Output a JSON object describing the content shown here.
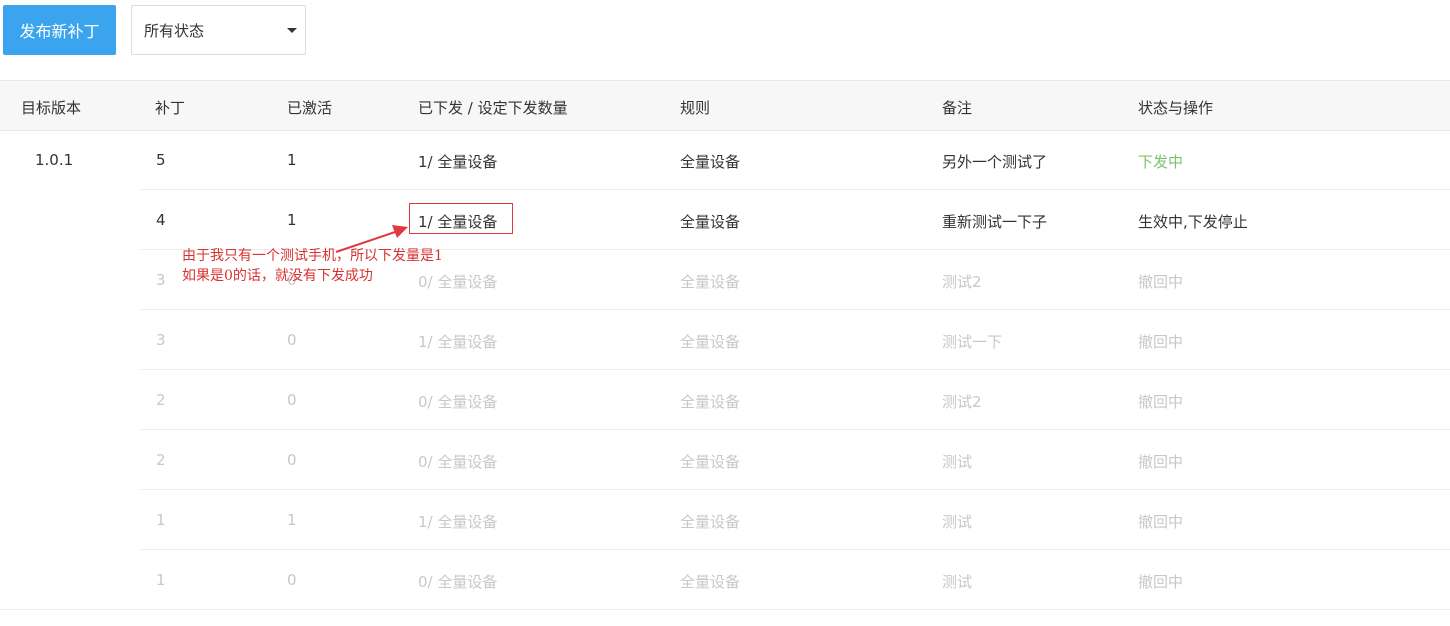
{
  "toolbar": {
    "publish_label": "发布新补丁",
    "status_select": "所有状态"
  },
  "table": {
    "headers": [
      "目标版本",
      "补丁",
      "已激活",
      "已下发 / 设定下发数量",
      "规则",
      "备注",
      "状态与操作"
    ],
    "version": "1.0.1",
    "rows": [
      {
        "patch": "5",
        "activated": "1",
        "issued": "1/ 全量设备",
        "rule": "全量设备",
        "note": "另外一个测试了",
        "status": "下发中"
      },
      {
        "patch": "4",
        "activated": "1",
        "issued": "1/ 全量设备",
        "rule": "全量设备",
        "note": "重新测试一下子",
        "status": "生效中,下发停止"
      },
      {
        "patch": "3",
        "activated": "0",
        "issued": "0/ 全量设备",
        "rule": "全量设备",
        "note": "测试2",
        "status": "撤回中"
      },
      {
        "patch": "3",
        "activated": "0",
        "issued": "1/ 全量设备",
        "rule": "全量设备",
        "note": "测试一下",
        "status": "撤回中"
      },
      {
        "patch": "2",
        "activated": "0",
        "issued": "0/ 全量设备",
        "rule": "全量设备",
        "note": "测试2",
        "status": "撤回中"
      },
      {
        "patch": "2",
        "activated": "0",
        "issued": "0/ 全量设备",
        "rule": "全量设备",
        "note": "测试",
        "status": "撤回中"
      },
      {
        "patch": "1",
        "activated": "1",
        "issued": "1/ 全量设备",
        "rule": "全量设备",
        "note": "测试",
        "status": "撤回中"
      },
      {
        "patch": "1",
        "activated": "0",
        "issued": "0/ 全量设备",
        "rule": "全量设备",
        "note": "测试",
        "status": "撤回中"
      }
    ]
  },
  "annotation": {
    "line1": "由于我只有一个测试手机，所以下发量是1",
    "line2": "如果是0的话，就没有下发成功"
  },
  "colors": {
    "primary": "#3aa5ee",
    "status_active": "#7cc36a",
    "annotation": "#e2393e"
  }
}
